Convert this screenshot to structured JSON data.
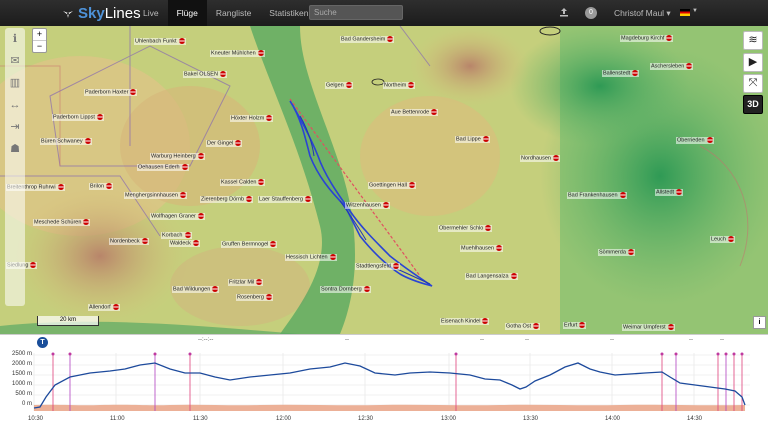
{
  "nav": {
    "brand": {
      "sky": "Sky",
      "lines": "Lines"
    },
    "links": [
      {
        "label": "Live",
        "active": false
      },
      {
        "label": "Flüge",
        "active": true
      },
      {
        "label": "Rangliste",
        "active": false
      },
      {
        "label": "Statistiken",
        "active": false
      }
    ],
    "search_placeholder": "Suche",
    "notification_count": "0",
    "user": "Christof Maul ▾"
  },
  "map": {
    "zoom_in": "+",
    "zoom_out": "−",
    "scale_label": "20 km",
    "right_buttons": {
      "threed_label": "3D"
    },
    "info_label": "i",
    "places": [
      {
        "name": "Uhlenbach Funkt"
      },
      {
        "name": "Kneuter Mühlchen"
      },
      {
        "name": "Bad Gandersheim"
      },
      {
        "name": "Magdeburg Kirchf"
      },
      {
        "name": "Bakel OLSEN"
      },
      {
        "name": "Ballenstedt"
      },
      {
        "name": "Aschersleben"
      },
      {
        "name": "Paderborn Haxter"
      },
      {
        "name": "Gelgen"
      },
      {
        "name": "Northeim"
      },
      {
        "name": "Paderborn Lippst"
      },
      {
        "name": "Höxter Holzm"
      },
      {
        "name": "Aue Bettenrode"
      },
      {
        "name": "Büren Schwaney"
      },
      {
        "name": "Bad Lippe"
      },
      {
        "name": "Der Gingel"
      },
      {
        "name": "Oberrieden"
      },
      {
        "name": "Warburg Heinberg"
      },
      {
        "name": "Nordhausen"
      },
      {
        "name": "Oehausen Ederh"
      },
      {
        "name": "Kassel Calden"
      },
      {
        "name": "Goettingen Hall"
      },
      {
        "name": "Breitenthrop Ruhrwi"
      },
      {
        "name": "Brilon"
      },
      {
        "name": "Menghergsinnhausen"
      },
      {
        "name": "Zierenberg Dörnb"
      },
      {
        "name": "Laer Stauffenberg"
      },
      {
        "name": "Witzenhausen"
      },
      {
        "name": "Bad Frankenhausen"
      },
      {
        "name": "Allstedt"
      },
      {
        "name": "Wolfhagen Graner"
      },
      {
        "name": "Meschede Schüren"
      },
      {
        "name": "Obermehler Schlo"
      },
      {
        "name": "Nordenbeck"
      },
      {
        "name": "Korbach"
      },
      {
        "name": "Waldeck"
      },
      {
        "name": "Gruffen Bermnogel"
      },
      {
        "name": "Sömmerda"
      },
      {
        "name": "Leuch"
      },
      {
        "name": "Hessisch Lichten"
      },
      {
        "name": "Muehlhausen"
      },
      {
        "name": "Stadtlengsfeld"
      },
      {
        "name": "Bad Langensalza"
      },
      {
        "name": "Fritzlar Mil"
      },
      {
        "name": "Bad Wildungen"
      },
      {
        "name": "Sontra Dornberg"
      },
      {
        "name": "Rosenberg"
      },
      {
        "name": "Allendorf"
      },
      {
        "name": "Eisenach Kindel"
      },
      {
        "name": "Gotha Ost"
      },
      {
        "name": "Erfurt"
      },
      {
        "name": "Weimar Umpferst"
      },
      {
        "name": "Siedlung"
      }
    ]
  },
  "baro": {
    "badge": "T",
    "y_labels": [
      "2500 m",
      "2000 m",
      "1500 m",
      "1000 m",
      "500 m",
      "0 m"
    ],
    "x_labels": [
      "10:30",
      "11:00",
      "11:30",
      "12:00",
      "12:30",
      "13:00",
      "13:30",
      "14:00",
      "14:30"
    ],
    "markers_top": [
      "--:--:--",
      "--",
      "--",
      "--",
      "--",
      "--",
      "--"
    ]
  }
}
